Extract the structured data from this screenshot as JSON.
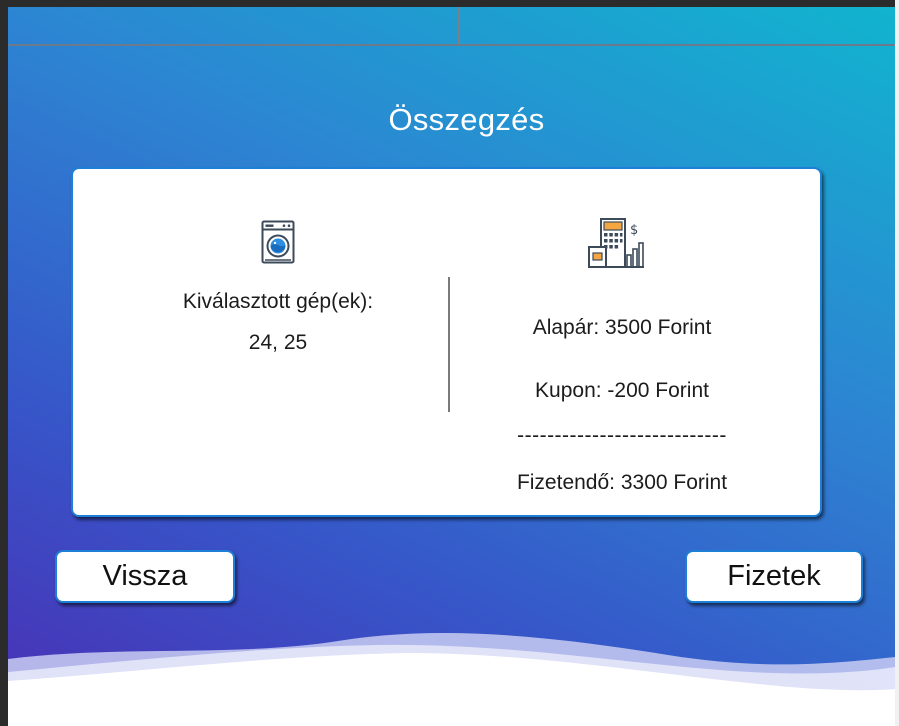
{
  "summary": {
    "title": "Összegzés",
    "machines_label": "Kiválasztott gép(ek):",
    "machines_value": "24, 25",
    "base_price": "Alapár: 3500 Forint",
    "coupon": "Kupon: -200 Forint",
    "separator": "----------------------------",
    "total": "Fizetendő: 3300 Forint"
  },
  "buttons": {
    "back_label": "Vissza",
    "pay_label": "Fizetek"
  },
  "icons": {
    "machine": "washing-machine-icon",
    "price": "finance-building-icon"
  },
  "colors": {
    "gradient_start": "#4a2fb5",
    "gradient_end": "#11b4cf",
    "accent_border": "#1d7fd6",
    "icon_stroke": "#3c4a5a",
    "icon_blue": "#2e8fe0",
    "icon_orange": "#f4a640"
  }
}
